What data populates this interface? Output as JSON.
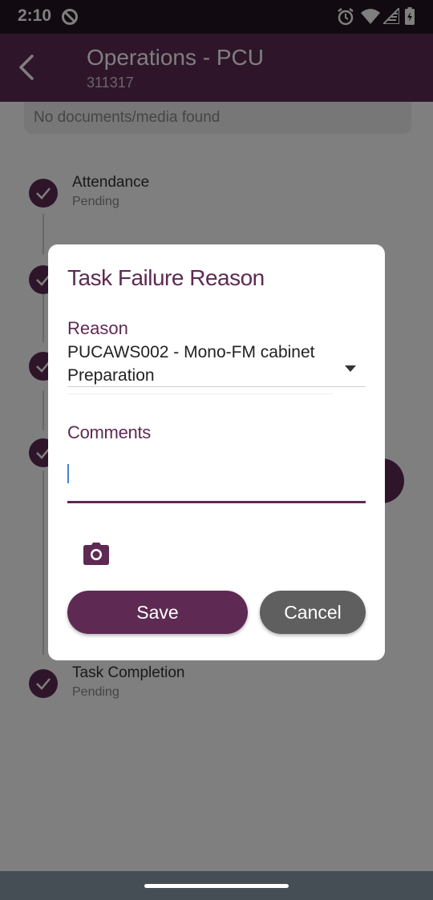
{
  "status_bar": {
    "time": "2:10",
    "icons": [
      "do-not-disturb-icon",
      "alarm-icon",
      "wifi-icon",
      "signal-icon",
      "battery-icon"
    ]
  },
  "app_bar": {
    "title": "Operations - PCU",
    "subtitle": "311317"
  },
  "background": {
    "no_documents": "No documents/media found",
    "steps": [
      {
        "label": "Attendance",
        "status": "Pending"
      },
      {
        "label": "Task Completion",
        "status": "Pending"
      }
    ]
  },
  "dialog": {
    "title": "Task Failure Reason",
    "reason_label": "Reason",
    "reason_value": "PUCAWS002 - Mono-FM cabinet Preparation",
    "comments_label": "Comments",
    "comments_value": "",
    "save_label": "Save",
    "cancel_label": "Cancel"
  },
  "colors": {
    "brand": "#5e2a54",
    "cancel": "#5f5f5f",
    "scrim": "rgba(0,0,0,0.5)"
  }
}
